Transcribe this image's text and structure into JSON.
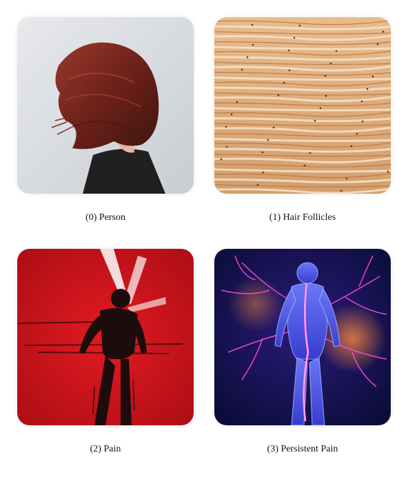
{
  "panels": [
    {
      "caption": "(0) Person",
      "image": "person-with-red-hair-photo"
    },
    {
      "caption": "(1) Hair Follicles",
      "image": "hair-follicles-closeup"
    },
    {
      "caption": "(2) Pain",
      "image": "pain-red-figure-illustration"
    },
    {
      "caption": "(3) Persistent Pain",
      "image": "persistent-pain-nerves-illustration"
    }
  ],
  "colors": {
    "background": "#ffffff",
    "hair": "#7a2a22",
    "pain_red": "#d4121b",
    "nerve_glow": "#ff4fd8",
    "night_blue": "#0a0f3a"
  }
}
